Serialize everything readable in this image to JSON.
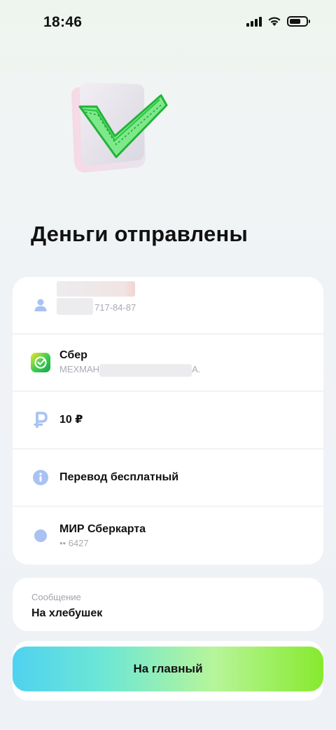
{
  "status_bar": {
    "time": "18:46"
  },
  "page": {
    "title": "Деньги отправлены"
  },
  "details": {
    "recipient": {
      "phone_tail": "717-84-87"
    },
    "bank": {
      "name": "Сбер",
      "holder_prefix": "МЕХМАН",
      "holder_suffix": "А."
    },
    "amount": {
      "value": "10 ₽"
    },
    "fee": {
      "text": "Перевод бесплатный"
    },
    "card": {
      "name": "МИР Сберкарта",
      "number": "•• 6427"
    }
  },
  "message": {
    "label": "Сообщение",
    "text": "На хлебушек"
  },
  "actions": {
    "home_label": "На главный"
  },
  "colors": {
    "icon_accent": "#a8c2f2",
    "sber_green": "#21a038",
    "button_start": "#4fd2f0",
    "button_end": "#86ea2d"
  }
}
